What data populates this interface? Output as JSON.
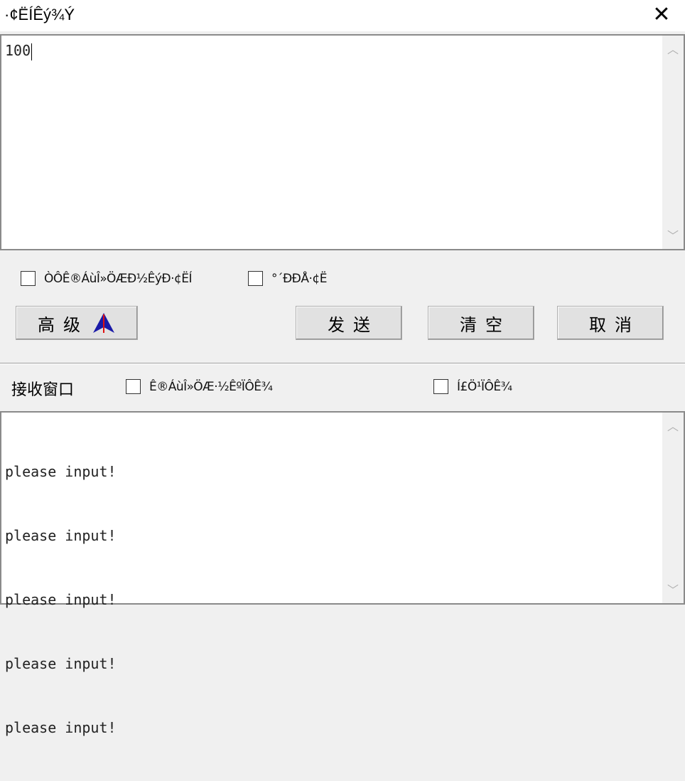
{
  "window": {
    "title": "·¢ËÍÊý¾Ý",
    "close_glyph": "✕"
  },
  "send_box": {
    "value": "100"
  },
  "options": {
    "send_checkbox_1": "ÒÔÊ®ÁùÎ»ÖÆÐ½ÊýÐ·¢ËÍ",
    "send_checkbox_2": "°´ÐÐÅ·¢Ë"
  },
  "buttons": {
    "advanced": "高级",
    "send": "发送",
    "clear": "清空",
    "cancel": "取消"
  },
  "receive": {
    "label": "接收窗口",
    "checkbox_1": "Ê®ÁùÎ»ÖÆ·½ÊºÏÔÊ¾",
    "checkbox_2": "Í£Ö¹ÏÔÊ¾",
    "lines": [
      "please input!",
      "please input!",
      "please input!",
      "please input!",
      "please input!"
    ]
  },
  "colors": {
    "advanced_icon_blue": "#1a1aa8",
    "advanced_icon_red": "#e01010"
  },
  "icons": {
    "advanced": "double-arrow-up-icon",
    "scroll_up": "chevron-up-icon",
    "scroll_down": "chevron-down-icon"
  }
}
